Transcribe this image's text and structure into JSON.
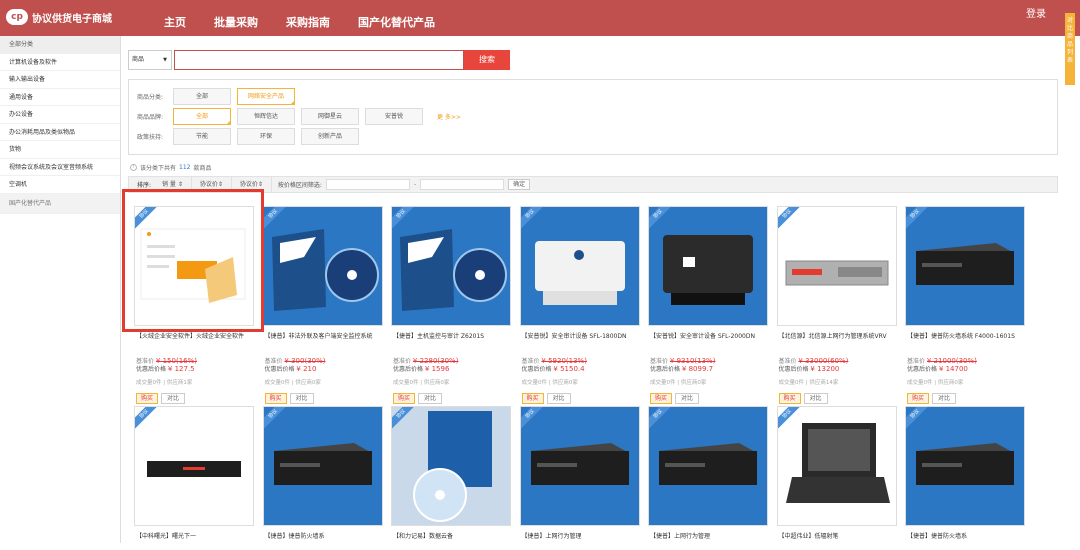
{
  "header": {
    "logo": "协议供货电子商城",
    "logo_mark": "cp",
    "nav": [
      "主页",
      "批量采购",
      "采购指南",
      "国产化替代产品"
    ],
    "login": "登录",
    "side_tab": "对比商品列表"
  },
  "sidebar": {
    "head": "全部分类",
    "items": [
      "计算机设备及软件",
      "输入输出设备",
      "通用设备",
      "办公设备",
      "办公消耗用品及类似物品",
      "货物",
      "视频会议系统及会议室音频系统",
      "空调机"
    ],
    "last": "国产化替代产品"
  },
  "search": {
    "category": "商品",
    "button": "搜索"
  },
  "filter": {
    "row1_label": "商品分类:",
    "row1": [
      {
        "label": "全部",
        "selected": false
      },
      {
        "label": "网络安全产品",
        "selected": true
      }
    ],
    "row2_label": "商品品牌:",
    "row2": [
      {
        "label": "全部",
        "selected": true
      },
      {
        "label": "恒辉信达",
        "selected": false
      },
      {
        "label": "网御星云",
        "selected": false
      },
      {
        "label": "安普锐",
        "selected": false
      }
    ],
    "more": "更 多>>",
    "row3_label": "政策扶持:",
    "row3": [
      {
        "label": "节能",
        "selected": false
      },
      {
        "label": "环保",
        "selected": false
      },
      {
        "label": "创新产品",
        "selected": false
      }
    ]
  },
  "count": {
    "prefix": "该分类下共有",
    "num": "112",
    "suffix": "款商品"
  },
  "sortbar": {
    "label": "排序:",
    "options": [
      "销 量 ⇕",
      "协议价⇕",
      "协议价⇕"
    ],
    "range_label": "按价格区间筛选:",
    "dash": "-",
    "confirm": "确定"
  },
  "badge": "协议",
  "buy_label": "购买",
  "compare_label": "对比",
  "price_prefix1": "基准价 ",
  "price_prefix2": "优惠后价格 ",
  "products": [
    {
      "title": "【火绒企业安全软件】火绒企业安全软件",
      "base": "¥ 150(16%)",
      "discount": "¥ 127.5",
      "stats": "成交量0件 | 供应商1家",
      "img": "software",
      "accent": "#f5c97a"
    },
    {
      "title": "【捷普】非法外联及客户端安全监控系统",
      "base": "¥ 300(30%)",
      "discount": "¥ 210",
      "stats": "成交量0件 | 供应商0家",
      "img": "box",
      "accent": "#1d5fa8"
    },
    {
      "title": "【捷普】主机监控与审计 Z6201S",
      "base": "¥ 2280(30%)",
      "discount": "¥ 1596",
      "stats": "成交量0件 | 供应商0家",
      "img": "box",
      "accent": "#1d5fa8"
    },
    {
      "title": "【安普锐】安全审计设备 SFL-1800DN",
      "base": "¥ 5920(13%)",
      "discount": "¥ 5150.4",
      "stats": "成交量0件 | 供应商0家",
      "img": "printer-white",
      "accent": "#e8e8e8"
    },
    {
      "title": "【安普锐】安全审计设备 SFL-2000DN",
      "base": "¥ 9310(13%)",
      "discount": "¥ 8099.7",
      "stats": "成交量0件 | 供应商0家",
      "img": "printer-black",
      "accent": "#2b2b2b"
    },
    {
      "title": "【北信源】北信源上网行为管理系统VRV",
      "base": "¥ 33000(60%)",
      "discount": "¥ 13200",
      "stats": "成交量0件 | 供应商14家",
      "img": "rack",
      "accent": "#b0b0b0"
    },
    {
      "title": "【捷普】捷普防火墙系统 F4000-1601S",
      "base": "¥ 21000(30%)",
      "discount": "¥ 14700",
      "stats": "成交量0件 | 供应商0家",
      "img": "appliance",
      "accent": "#1e1e1e"
    },
    {
      "title": "【中科曙光】曙光下一",
      "img": "flatbox",
      "accent": "#1e1e1e"
    },
    {
      "title": "【捷普】捷普防火墙系",
      "img": "appliance",
      "accent": "#1e1e1e"
    },
    {
      "title": "【和力记易】数据云备",
      "img": "cd",
      "accent": "#1d5fa8"
    },
    {
      "title": "【捷普】上网行为管理",
      "img": "appliance",
      "accent": "#1e1e1e"
    },
    {
      "title": "【捷普】上网行为管理",
      "img": "appliance",
      "accent": "#1e1e1e"
    },
    {
      "title": "【中超伟业】低辐射笔",
      "img": "laptop",
      "accent": "#2a2a2a"
    },
    {
      "title": "【捷普】捷普防火墙系",
      "img": "appliance",
      "accent": "#1e1e1e"
    }
  ]
}
